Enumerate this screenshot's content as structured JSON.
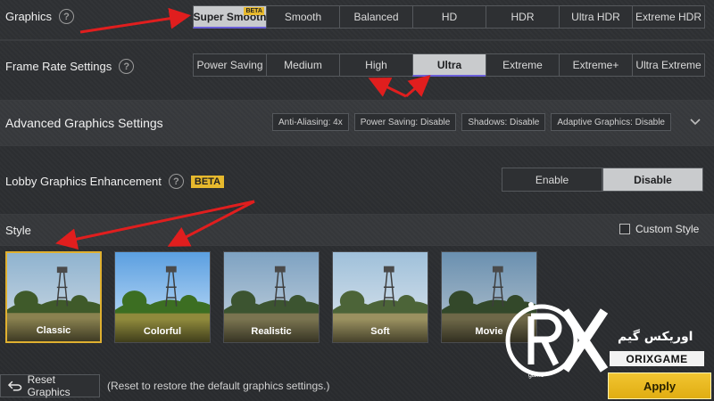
{
  "graphics": {
    "label": "Graphics",
    "options": [
      "Super Smooth",
      "Smooth",
      "Balanced",
      "HD",
      "HDR",
      "Ultra HDR",
      "Extreme HDR"
    ],
    "selected_index": 0,
    "beta_tag": "BETA"
  },
  "frame_rate": {
    "label": "Frame Rate Settings",
    "options": [
      "Power Saving",
      "Medium",
      "High",
      "Ultra",
      "Extreme",
      "Extreme+",
      "Ultra Extreme"
    ],
    "selected_index": 3
  },
  "advanced": {
    "label": "Advanced Graphics Settings",
    "chips": [
      "Anti-Aliasing: 4x",
      "Power Saving: Disable",
      "Shadows: Disable",
      "Adaptive Graphics: Disable"
    ],
    "chevron_icon": "chevron-down-icon"
  },
  "lobby": {
    "label": "Lobby Graphics Enhancement",
    "badge": "BETA",
    "options": [
      "Enable",
      "Disable"
    ],
    "selected_index": 1
  },
  "style": {
    "label": "Style",
    "custom_style_label": "Custom Style",
    "custom_style_checked": false,
    "thumbnails": [
      "Classic",
      "Colorful",
      "Realistic",
      "Soft",
      "Movie"
    ],
    "selected_index": 0
  },
  "footer": {
    "reset_label": "Reset Graphics",
    "reset_note": "(Reset to restore the default graphics settings.)",
    "apply_label": "Apply"
  },
  "watermark": {
    "persian_text": "اوریکس گیم",
    "brand": "ORIXGAME",
    "sub": "game"
  },
  "colors": {
    "accent_yellow": "#e7b92d",
    "selected_underline": "#6a5fd8",
    "arrow_red": "#e01e1e"
  }
}
